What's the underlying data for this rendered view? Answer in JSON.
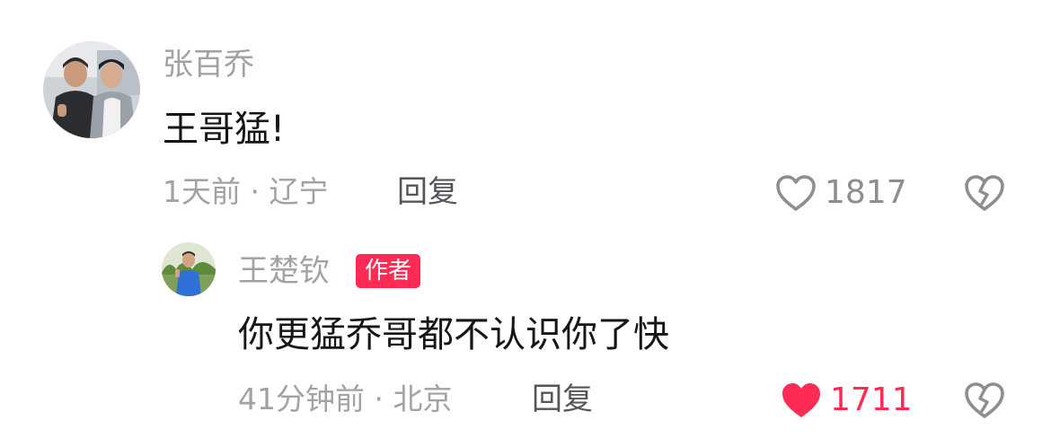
{
  "comment": {
    "author": "张百乔",
    "text": "王哥猛!",
    "time_location": "1天前 · 辽宁",
    "reply_label": "回复",
    "like_count": "1817",
    "liked": false
  },
  "reply": {
    "author": "王楚钦",
    "author_badge": "作者",
    "text": "你更猛乔哥都不认识你了快",
    "time_location": "41分钟前 · 北京",
    "reply_label": "回复",
    "like_count": "1711",
    "liked": true
  },
  "colors": {
    "accent": "#fe2c55",
    "muted_text": "#a2a2a6",
    "body_text": "#16161a",
    "reply_link": "#55555b"
  },
  "icons": {
    "like": "heart-outline-icon",
    "liked": "heart-filled-icon",
    "dislike": "broken-heart-icon"
  }
}
